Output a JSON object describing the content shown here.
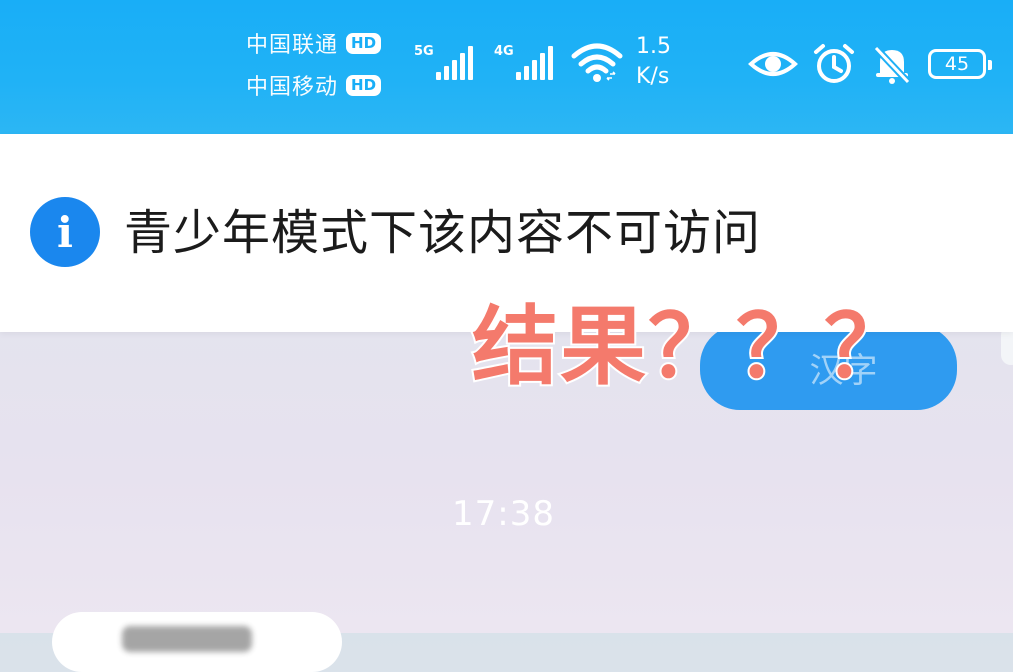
{
  "status_bar": {
    "carriers": [
      {
        "name": "中国联通",
        "badge": "HD"
      },
      {
        "name": "中国移动",
        "badge": "HD"
      }
    ],
    "signals": [
      {
        "network": "5G"
      },
      {
        "network": "4G"
      }
    ],
    "speed_value": "1.5",
    "speed_unit": "K/s",
    "icons": [
      "eye-icon",
      "alarm-icon",
      "mute-bell-icon",
      "battery-icon"
    ],
    "battery_level": "45",
    "colors": {
      "bar": "#1fb0f6",
      "text": "#ffffff"
    }
  },
  "toast": {
    "icon": "info-icon",
    "icon_glyph": "i",
    "message": "青少年模式下该内容不可访问",
    "icon_color": "#1a87ee"
  },
  "chat": {
    "button_text": "汉字",
    "timestamp": "17:38"
  },
  "annotation": {
    "text": "结果？？？",
    "color": "#f47a6c"
  }
}
